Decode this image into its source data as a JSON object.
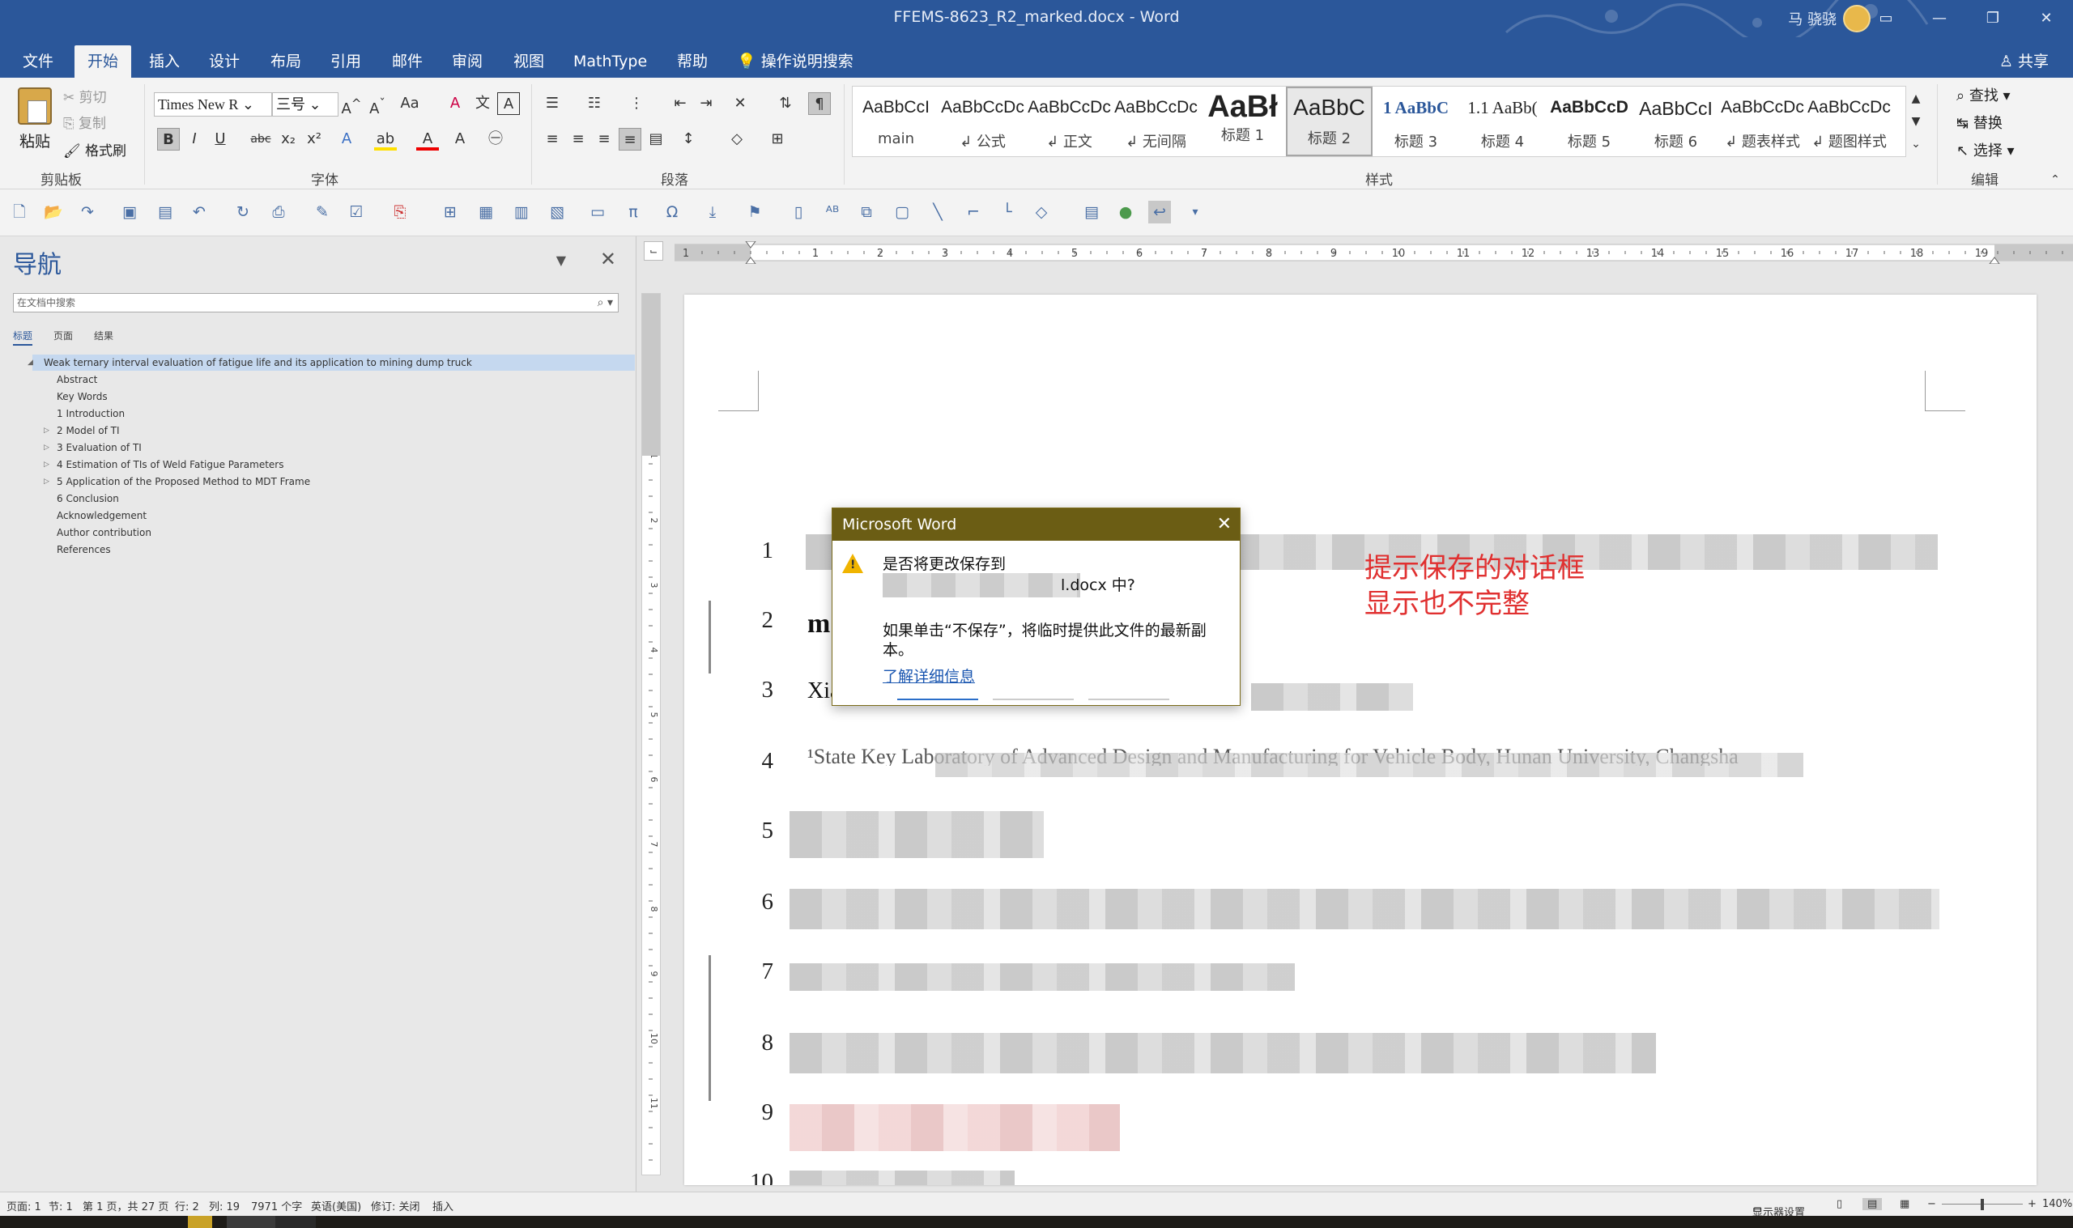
{
  "window": {
    "title": "FFEMS-8623_R2_marked.docx  -  Word",
    "user": "马 骁骁",
    "min": "—",
    "max": "❐",
    "close": "✕",
    "ribbon_display": "▭"
  },
  "tabs": [
    "文件",
    "开始",
    "插入",
    "设计",
    "布局",
    "引用",
    "邮件",
    "审阅",
    "视图",
    "MathType",
    "帮助"
  ],
  "active_tab": "开始",
  "tell_me": "操作说明搜索",
  "share": "共享",
  "ribbon": {
    "clipboard": {
      "paste": "粘贴",
      "cut": "剪切",
      "copy": "复制",
      "format_painter": "格式刷",
      "label": "剪贴板"
    },
    "font": {
      "name": "Times New R",
      "size": "三号",
      "label": "字体"
    },
    "paragraph": {
      "label": "段落"
    },
    "styles": {
      "label": "样式",
      "items": [
        {
          "preview": "AaBbCcI",
          "name": "main"
        },
        {
          "preview": "AaBbCcDc",
          "name": "↲ 公式"
        },
        {
          "preview": "AaBbCcDc",
          "name": "↲ 正文"
        },
        {
          "preview": "AaBbCcDc",
          "name": "↲ 无间隔"
        },
        {
          "preview": "AaBł",
          "name": "标题 1"
        },
        {
          "preview": "AaBbC",
          "name": "标题 2"
        },
        {
          "preview": "1  AaBbC",
          "name": "标题 3"
        },
        {
          "preview": "1.1  AaBb(",
          "name": "标题 4"
        },
        {
          "preview": "AaBbCcD",
          "name": "标题 5"
        },
        {
          "preview": "AaBbCcI",
          "name": "标题 6"
        },
        {
          "preview": "AaBbCcDc",
          "name": "↲ 题表样式"
        },
        {
          "preview": "AaBbCcDc",
          "name": "↲ 题图样式"
        }
      ],
      "selected_index": 5
    },
    "editing": {
      "find": "查找",
      "replace": "替换",
      "select": "选择",
      "label": "编辑"
    }
  },
  "nav": {
    "title": "导航",
    "search_placeholder": "在文档中搜索",
    "tabs": [
      "标题",
      "页面",
      "结果"
    ],
    "items": [
      {
        "text": "Weak ternary interval evaluation of fatigue life and its application to mining dump truck",
        "level": 0,
        "expand": "◢",
        "selected": true
      },
      {
        "text": "Abstract",
        "level": 1,
        "expand": ""
      },
      {
        "text": "Key Words",
        "level": 1,
        "expand": ""
      },
      {
        "text": "1 Introduction",
        "level": 1,
        "expand": ""
      },
      {
        "text": "2 Model of TI",
        "level": 1,
        "expand": "▷"
      },
      {
        "text": "3 Evaluation of TI",
        "level": 1,
        "expand": "▷"
      },
      {
        "text": "4  Estimation of TIs of Weld Fatigue Parameters",
        "level": 1,
        "expand": "▷"
      },
      {
        "text": "5 Application of the Proposed Method to MDT Frame",
        "level": 1,
        "expand": "▷"
      },
      {
        "text": "6 Conclusion",
        "level": 1,
        "expand": ""
      },
      {
        "text": "Acknowledgement",
        "level": 1,
        "expand": ""
      },
      {
        "text": "Author contribution",
        "level": 1,
        "expand": ""
      },
      {
        "text": "References",
        "level": 1,
        "expand": ""
      }
    ]
  },
  "ruler_numbers": [
    "2",
    "1",
    "1",
    "2",
    "3",
    "4",
    "5",
    "6",
    "7",
    "8",
    "9",
    "10",
    "11",
    "12",
    "13",
    "14",
    "15",
    "16",
    "17",
    "18",
    "19"
  ],
  "vruler_numbers": [
    "2",
    "1",
    "1",
    "2",
    "3",
    "4",
    "5",
    "6",
    "7",
    "8",
    "9",
    "10",
    "11"
  ],
  "document": {
    "line_numbers": [
      "1",
      "2",
      "3",
      "4",
      "5",
      "6",
      "7",
      "8",
      "9",
      "10"
    ],
    "line2_start": "m",
    "line3_start": "Xia",
    "line4_text": "¹State Key Laboratory of Advanced Design and Manufacturing for Vehicle Body, Hunan University, Changsha"
  },
  "annotation": {
    "line1": "提示保存的对话框",
    "line2": "显示也不完整"
  },
  "dialog": {
    "title": "Microsoft Word",
    "close": "✕",
    "question_line1": "是否将更改保存到",
    "question_line2": "l.docx 中?",
    "info_line1": "如果单击“不保存”，将临时提供此文件的最新副",
    "info_line2": "本。",
    "link": "了解详细信息"
  },
  "status": {
    "page": "页面: 1",
    "section": "节: 1",
    "pages": "第 1 页，共 27 页",
    "row": "行: 2",
    "col": "列: 19",
    "words": "7971 个字",
    "lang": "英语(美国)",
    "track": "修订: 关闭",
    "insert": "插入",
    "display": "显示器设置",
    "zoom": "140%"
  }
}
